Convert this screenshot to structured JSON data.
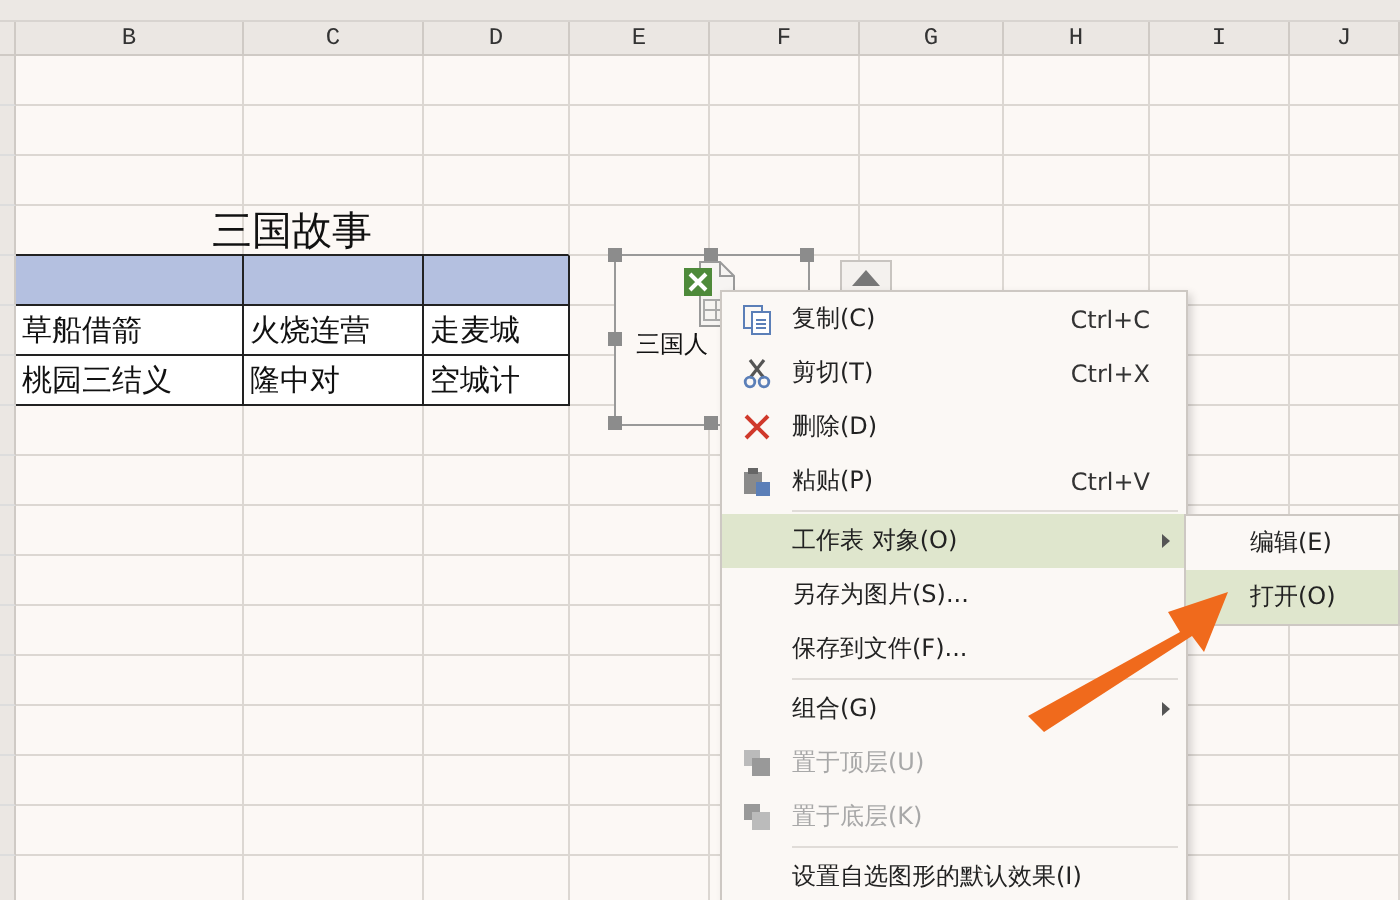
{
  "sheet": {
    "columns": [
      "B",
      "C",
      "D",
      "E",
      "F",
      "G",
      "H",
      "I",
      "J"
    ],
    "table": {
      "title": "三国故事",
      "rows": [
        [
          "草船借箭",
          "火烧连营",
          "走麦城"
        ],
        [
          "桃园三结义",
          "隆中对",
          "空城计"
        ]
      ]
    }
  },
  "embedded_object": {
    "label": "三国人"
  },
  "context_menu": {
    "items": [
      {
        "kind": "item",
        "label": "复制(C)",
        "shortcut": "Ctrl+C",
        "disabled": false,
        "selected": false,
        "submenu": false
      },
      {
        "kind": "item",
        "label": "剪切(T)",
        "shortcut": "Ctrl+X",
        "disabled": false,
        "selected": false,
        "submenu": false
      },
      {
        "kind": "item",
        "label": "删除(D)",
        "disabled": false,
        "selected": false,
        "submenu": false
      },
      {
        "kind": "item",
        "label": "粘贴(P)",
        "shortcut": "Ctrl+V",
        "disabled": false,
        "selected": false,
        "submenu": false
      },
      {
        "kind": "separator"
      },
      {
        "kind": "item",
        "label": "工作表 对象(O)",
        "disabled": false,
        "selected": true,
        "submenu": true
      },
      {
        "kind": "item",
        "label": "另存为图片(S)...",
        "disabled": false,
        "selected": false,
        "submenu": false
      },
      {
        "kind": "item",
        "label": "保存到文件(F)...",
        "disabled": false,
        "selected": false,
        "submenu": false
      },
      {
        "kind": "separator"
      },
      {
        "kind": "item",
        "label": "组合(G)",
        "disabled": false,
        "selected": false,
        "submenu": true
      },
      {
        "kind": "item",
        "label": "置于顶层(U)",
        "disabled": true,
        "selected": false,
        "submenu": false
      },
      {
        "kind": "item",
        "label": "置于底层(K)",
        "disabled": true,
        "selected": false,
        "submenu": false
      },
      {
        "kind": "separator"
      },
      {
        "kind": "item",
        "label": "设置自选图形的默认效果(I)",
        "disabled": false,
        "selected": false,
        "submenu": false
      }
    ]
  },
  "submenu": {
    "items": [
      {
        "label": "编辑(E)",
        "selected": false
      },
      {
        "label": "打开(O)",
        "selected": true
      }
    ]
  }
}
